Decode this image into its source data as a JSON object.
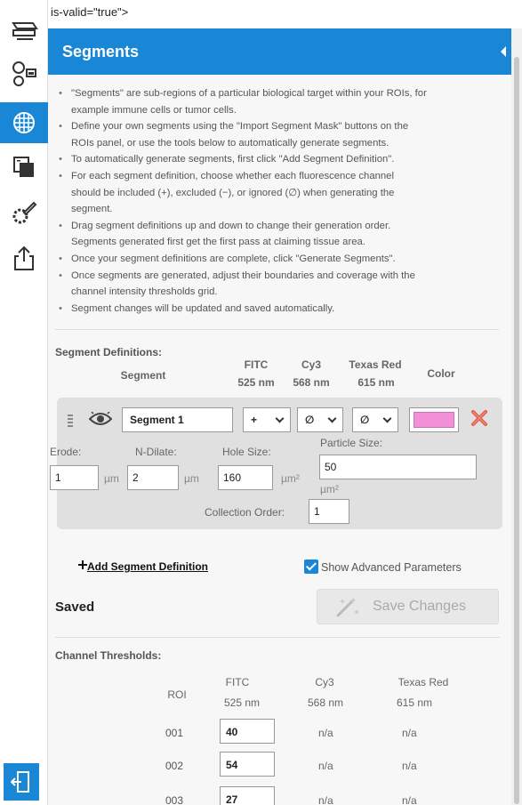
{
  "raw_text": "is-valid=\"true\">",
  "panel": {
    "title": "Segments",
    "instructions": [
      "\"Segments\" are sub-regions of a particular biological target within your ROIs, for",
      "example immune cells or tumor cells.",
      "Define your own segments using the \"Import Segment Mask\" buttons on the",
      "ROIs panel, or use the tools below to automatically generate segments.",
      "To automatically generate segments, first click \"Add Segment Definition\".",
      "For each segment definition, choose whether each fluorescence channel",
      "should be included (+), excluded (−), or ignored (∅) when generating the",
      "segment.",
      "Drag segment definitions up and down to change their generation order.",
      "Segments generated first get the first pass at claiming tissue area.",
      "Once your segment definitions are complete, click \"Generate Segments\".",
      "Once segments are generated, adjust their boundaries and coverage with the",
      "channel intensity thresholds grid.",
      "Segment changes will be updated and saved automatically."
    ]
  },
  "segment_definitions": {
    "title": "Segment Definitions:",
    "headers": {
      "segment": "Segment",
      "fitc": "FITC",
      "fitc_nm": "525 nm",
      "cy3": "Cy3",
      "cy3_nm": "568 nm",
      "texas": "Texas Red",
      "texas_nm": "615 nm",
      "color": "Color"
    },
    "segment": {
      "name": "Segment 1",
      "fitc": "+",
      "cy3": "∅",
      "texas": "∅",
      "color": "#f28fd6",
      "erode_label": "Erode:",
      "erode": "1",
      "erode_unit": "µm",
      "ndilate_label": "N-Dilate:",
      "ndilate": "2",
      "ndilate_unit": "µm",
      "hole_label": "Hole Size:",
      "hole": "160",
      "hole_unit": "µm²",
      "particle_label": "Particle Size:",
      "particle": "50",
      "particle_unit": "µm²",
      "order_label": "Collection Order:",
      "order": "1"
    },
    "add_label": "Add Segment Definition",
    "advanced_label": "Show Advanced Parameters"
  },
  "status": {
    "saved": "Saved",
    "save_changes": "Save Changes"
  },
  "thresholds": {
    "title": "Channel Thresholds:",
    "headers": {
      "roi": "ROI",
      "fitc": "FITC",
      "fitc_nm": "525 nm",
      "cy3": "Cy3",
      "cy3_nm": "568 nm",
      "texas": "Texas Red",
      "texas_nm": "615 nm"
    },
    "rows": [
      {
        "roi": "001",
        "fitc": "40",
        "cy3": "n/a",
        "texas": "n/a"
      },
      {
        "roi": "002",
        "fitc": "54",
        "cy3": "n/a",
        "texas": "n/a"
      },
      {
        "roi": "003",
        "fitc": "27",
        "cy3": "n/a",
        "texas": "n/a"
      }
    ]
  },
  "colors": {
    "accent": "#1a86d6",
    "segment_color": "#f28fd6"
  },
  "icons": {
    "rail": [
      "scanner-icon",
      "roi-icon",
      "segments-icon",
      "layers-icon",
      "settings-edit-icon",
      "export-icon",
      "exit-icon"
    ]
  }
}
